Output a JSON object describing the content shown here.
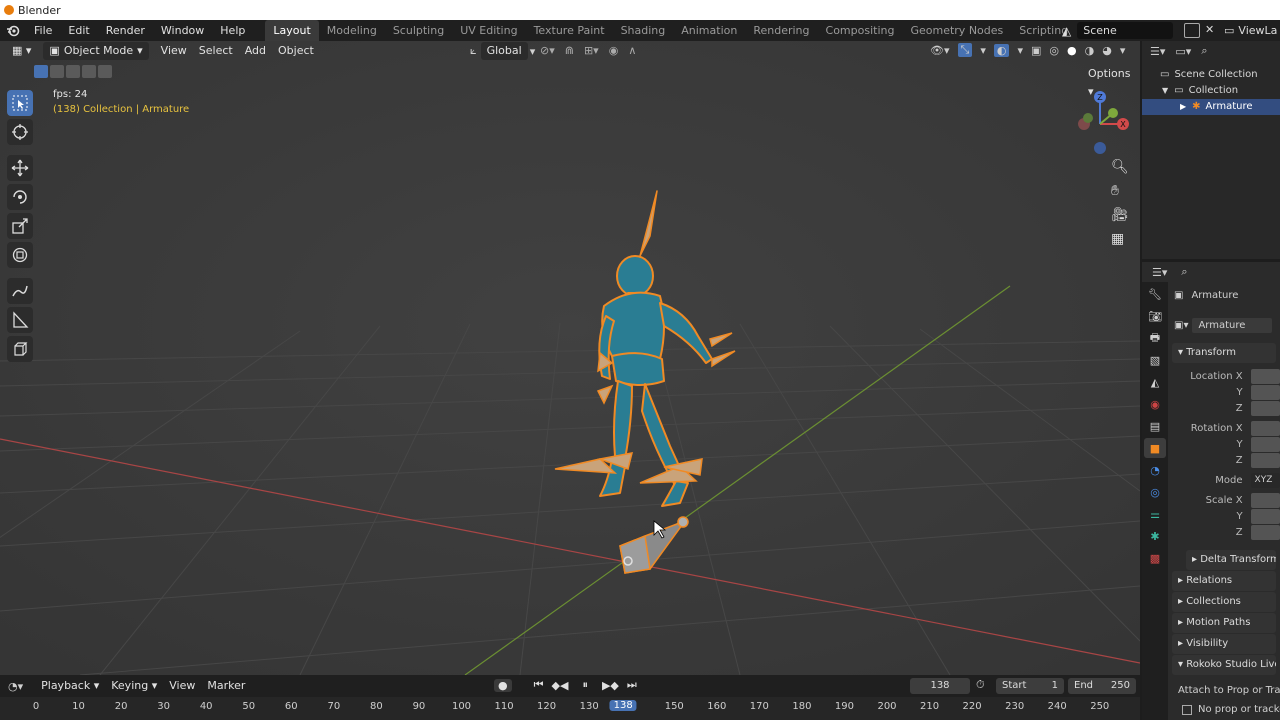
{
  "window": {
    "title": "Blender"
  },
  "menu": [
    "File",
    "Edit",
    "Render",
    "Window",
    "Help"
  ],
  "workspaces": [
    "Layout",
    "Modeling",
    "Sculpting",
    "UV Editing",
    "Texture Paint",
    "Shading",
    "Animation",
    "Rendering",
    "Compositing",
    "Geometry Nodes",
    "Scripting"
  ],
  "active_workspace": "Layout",
  "scene_name": "Scene",
  "view_layer": "ViewLa",
  "viewport": {
    "mode": "Object Mode",
    "menus": [
      "View",
      "Select",
      "Add",
      "Object"
    ],
    "transform_orientation": "Global",
    "options_label": "Options",
    "overlay_fps": "fps: 24",
    "overlay_info": "(138) Collection | Armature"
  },
  "outliner": {
    "root": "Scene Collection",
    "collection": "Collection",
    "object": "Armature"
  },
  "properties": {
    "object_name": "Armature",
    "data_name": "Armature",
    "transform_label": "Transform",
    "location_x": "Location X",
    "rotation_x": "Rotation X",
    "scale_x": "Scale X",
    "axis_y": "Y",
    "axis_z": "Z",
    "mode_label": "Mode",
    "mode_value": "XYZ E",
    "panels": [
      "Delta Transform",
      "Relations",
      "Collections",
      "Motion Paths",
      "Visibility",
      "Rokoko Studio Live Se"
    ],
    "attach_label": "Attach to Prop or Tracker",
    "no_prop": "No prop or tracker"
  },
  "timeline": {
    "menus": [
      "Playback",
      "Keying",
      "View",
      "Marker"
    ],
    "current_frame": "138",
    "start_label": "Start",
    "start_value": "1",
    "end_label": "End",
    "end_value": "250",
    "ruler": [
      "0",
      "10",
      "20",
      "30",
      "40",
      "50",
      "60",
      "70",
      "80",
      "90",
      "100",
      "110",
      "120",
      "130",
      "138",
      "150",
      "160",
      "170",
      "180",
      "190",
      "200",
      "210",
      "220",
      "230",
      "240",
      "250"
    ]
  },
  "colors": {
    "accent_blue": "#4772b3",
    "selection_orange": "#f08a24",
    "mesh_teal": "#2a7d93",
    "x_axis": "#a84545",
    "y_axis": "#6b8f32"
  }
}
